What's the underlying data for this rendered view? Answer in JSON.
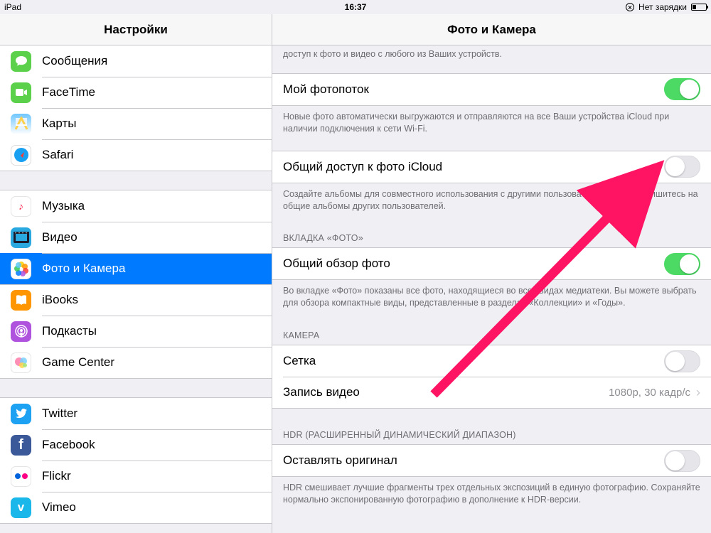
{
  "status": {
    "device": "iPad",
    "time": "16:37",
    "charge_label": "Нет зарядки"
  },
  "sidebar": {
    "title": "Настройки",
    "groups": [
      {
        "items": [
          {
            "id": "messages",
            "label": "Сообщения"
          },
          {
            "id": "facetime",
            "label": "FaceTime"
          },
          {
            "id": "maps",
            "label": "Карты"
          },
          {
            "id": "safari",
            "label": "Safari"
          }
        ]
      },
      {
        "items": [
          {
            "id": "music",
            "label": "Музыка"
          },
          {
            "id": "video",
            "label": "Видео"
          },
          {
            "id": "photos",
            "label": "Фото и Камера",
            "selected": true
          },
          {
            "id": "ibooks",
            "label": "iBooks"
          },
          {
            "id": "podcasts",
            "label": "Подкасты"
          },
          {
            "id": "gamecenter",
            "label": "Game Center"
          }
        ]
      },
      {
        "items": [
          {
            "id": "twitter",
            "label": "Twitter"
          },
          {
            "id": "facebook",
            "label": "Facebook"
          },
          {
            "id": "flickr",
            "label": "Flickr"
          },
          {
            "id": "vimeo",
            "label": "Vimeo"
          }
        ]
      }
    ]
  },
  "detail": {
    "title": "Фото и Камера",
    "top_footer": "доступ к фото и видео с любого из Ваших устройств.",
    "photostream": {
      "label": "Мой фотопоток",
      "on": true,
      "footer": "Новые фото автоматически выгружаются и отправляются на все Ваши устройства iCloud при наличии подключения к сети Wi-Fi."
    },
    "icloud_sharing": {
      "label": "Общий доступ к фото iCloud",
      "on": false,
      "footer": "Создайте альбомы для совместного использования с другими пользователями или подпишитесь на общие альбомы других пользователей."
    },
    "photos_tab": {
      "header": "ВКЛАДКА «ФОТО»",
      "label": "Общий обзор фото",
      "on": true,
      "footer": "Во вкладке «Фото» показаны все фото, находящиеся во всех видах медиатеки. Вы можете выбрать для обзора компактные виды, представленные в разделах «Коллекции» и «Годы»."
    },
    "camera": {
      "header": "КАМЕРА",
      "grid": {
        "label": "Сетка",
        "on": false
      },
      "record": {
        "label": "Запись видео",
        "value": "1080p, 30 кадр/с"
      }
    },
    "hdr": {
      "header": "HDR (РАСШИРЕННЫЙ ДИНАМИЧЕСКИЙ ДИАПАЗОН)",
      "keep_original": {
        "label": "Оставлять оригинал",
        "on": false
      },
      "footer": "HDR смешивает лучшие фрагменты трех отдельных экспозиций в единую фотографию. Сохраняйте нормально экспонированную фотографию в дополнение к HDR-версии."
    }
  }
}
